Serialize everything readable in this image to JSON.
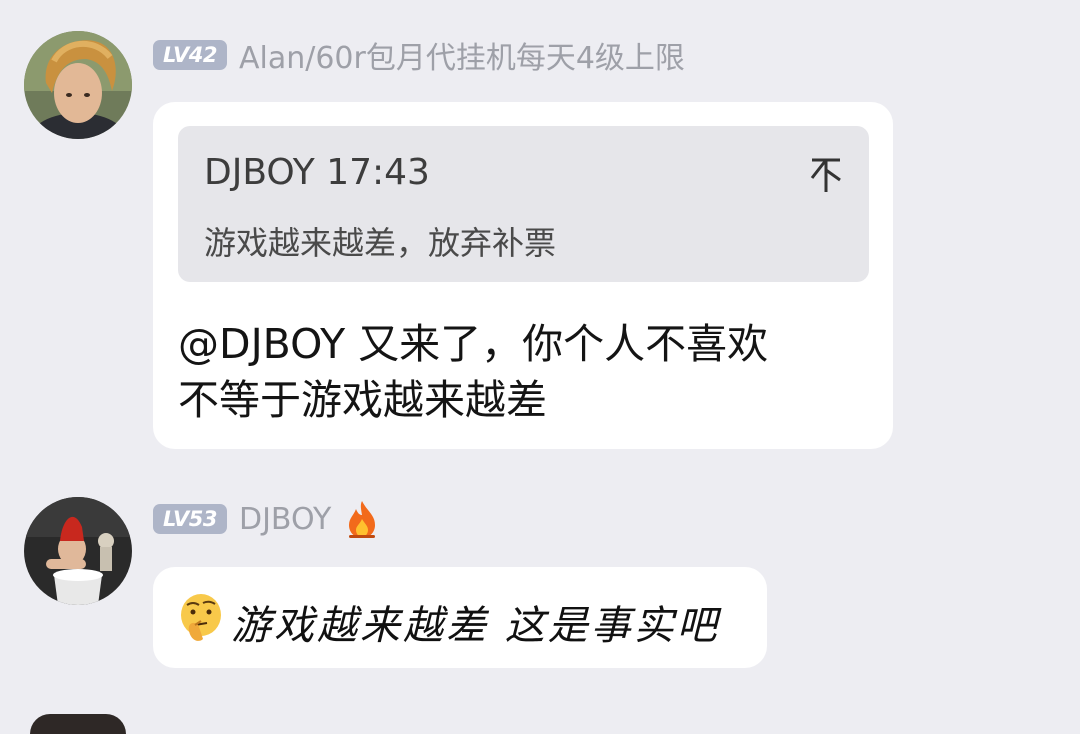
{
  "messages": [
    {
      "level": "LV42",
      "username": "Alan/60r包月代挂机每天4级上限",
      "quote": {
        "author": "DJBOY",
        "time": "17:43",
        "text": "游戏越来越差，放弃补票"
      },
      "text_line1": "@DJBOY 又来了，你个人不喜欢",
      "text_line2": "不等于游戏越来越差"
    },
    {
      "level": "LV53",
      "username": "DJBOY",
      "text": "游戏越来越差 这是事实吧"
    }
  ],
  "colors": {
    "background": "#ededf2",
    "bubble": "#ffffff",
    "quote_bg": "#e6e6ea",
    "level_badge": "#aeb5c8",
    "username": "#9ea0a8"
  },
  "icons": [
    "avatar-alan",
    "avatar-djboy",
    "jump-to-quote-icon",
    "fire-icon",
    "thinking-emoji"
  ]
}
